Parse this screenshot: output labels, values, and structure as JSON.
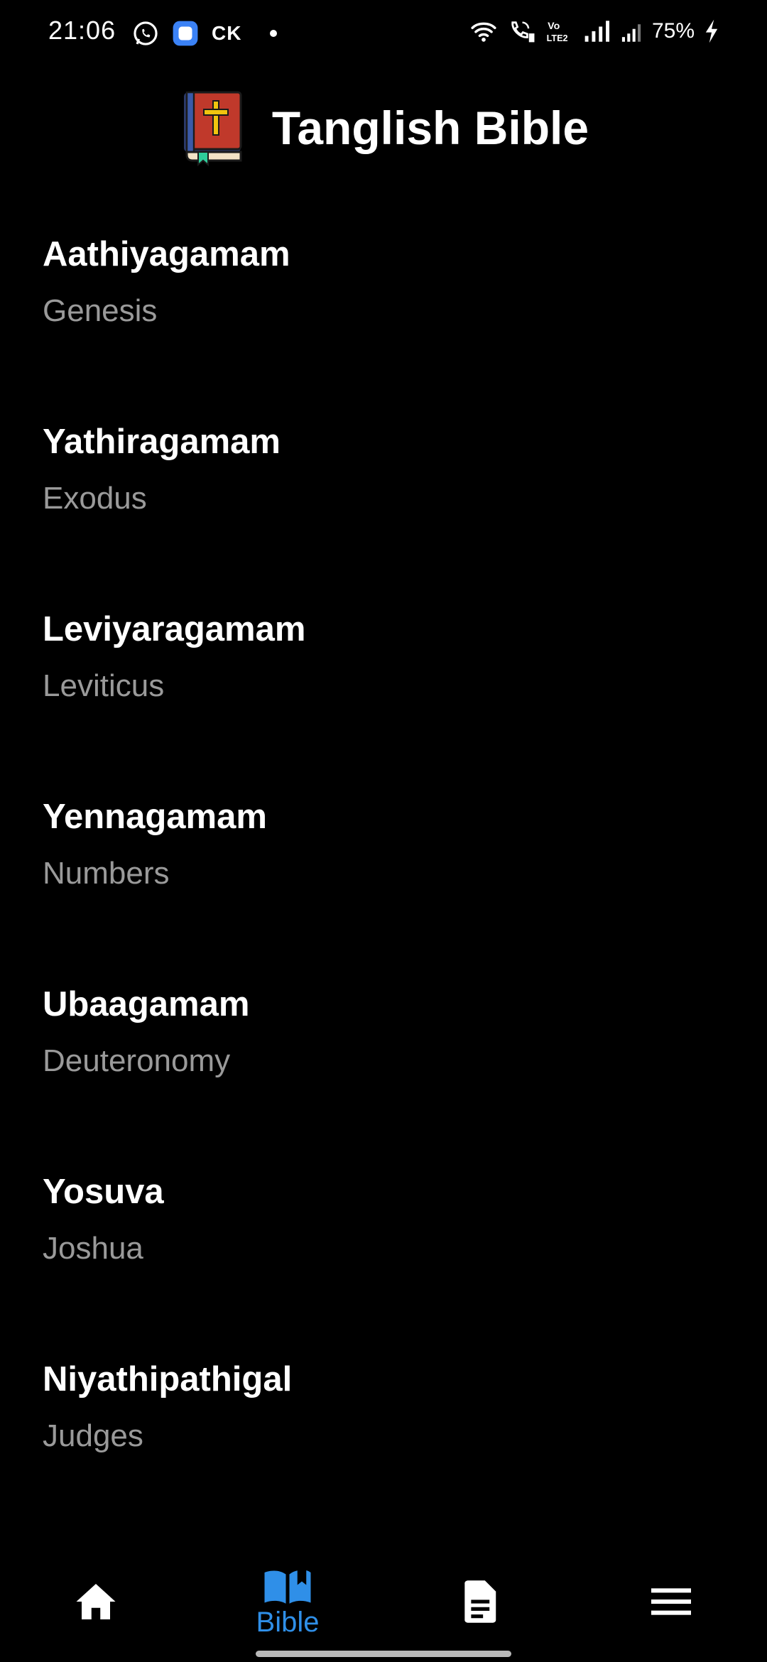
{
  "status_bar": {
    "time": "21:06",
    "carrier": "CK",
    "battery": "75%",
    "icons": [
      "whatsapp-icon",
      "app-notification-icon",
      "wifi-icon",
      "wifi-calling-icon",
      "volte-icon",
      "signal-icon",
      "signal-weak-icon",
      "charging-icon"
    ]
  },
  "header": {
    "title": "Tanglish Bible",
    "logo_icon": "bible-book-icon"
  },
  "books": [
    {
      "tanglish": "Aathiyagamam",
      "english": "Genesis"
    },
    {
      "tanglish": "Yathiragamam",
      "english": "Exodus"
    },
    {
      "tanglish": "Leviyaragamam",
      "english": "Leviticus"
    },
    {
      "tanglish": "Yennagamam",
      "english": "Numbers"
    },
    {
      "tanglish": "Ubaagamam",
      "english": "Deuteronomy"
    },
    {
      "tanglish": "Yosuva",
      "english": "Joshua"
    },
    {
      "tanglish": "Niyathipathigal",
      "english": "Judges"
    }
  ],
  "bottom_nav": {
    "active": "Bible",
    "items": [
      {
        "icon": "home-icon",
        "label": ""
      },
      {
        "icon": "open-book-icon",
        "label": "Bible"
      },
      {
        "icon": "document-icon",
        "label": ""
      },
      {
        "icon": "menu-icon",
        "label": ""
      }
    ],
    "active_color": "#2f8fe8"
  },
  "colors": {
    "background": "#000000",
    "primary_text": "#ffffff",
    "secondary_text": "#9a9a9a",
    "accent": "#2f8fe8"
  }
}
